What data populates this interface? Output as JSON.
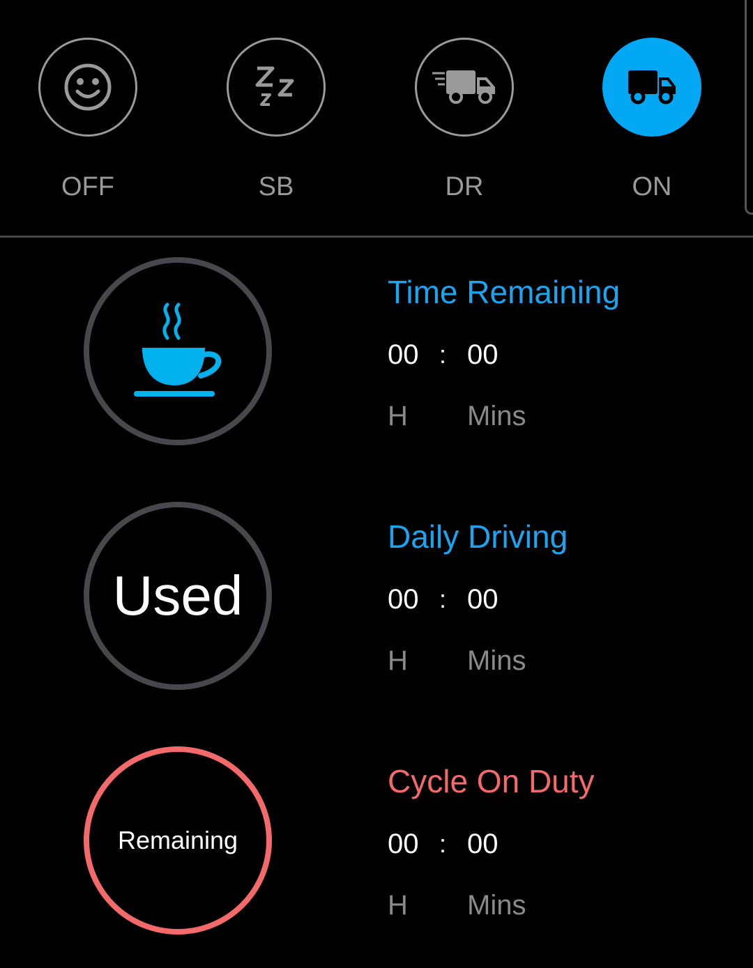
{
  "status_buttons": [
    {
      "label": "OFF",
      "icon": "smiley-icon",
      "active": false
    },
    {
      "label": "SB",
      "icon": "sleep-zzz-icon",
      "active": false
    },
    {
      "label": "DR",
      "icon": "moving-truck-icon",
      "active": false
    },
    {
      "label": "ON",
      "icon": "truck-icon",
      "active": true
    }
  ],
  "colors": {
    "accent_blue": "#02a8f4",
    "title_blue": "#1ba4ef",
    "warning_red": "#f46a6a",
    "ring_gray": "#48484c",
    "label_gray": "#9a9a9a"
  },
  "rows": [
    {
      "circle_icon": "coffee-cup-icon",
      "title": "Time Remaining",
      "hours": "00",
      "separator": ":",
      "minutes": "00",
      "hours_unit": "H",
      "minutes_unit": "Mins"
    },
    {
      "circle_text": "Used",
      "title": "Daily Driving",
      "hours": "00",
      "separator": ":",
      "minutes": "00",
      "hours_unit": "H",
      "minutes_unit": "Mins"
    },
    {
      "circle_text": "Remaining",
      "title": "Cycle On Duty",
      "hours": "00",
      "separator": ":",
      "minutes": "00",
      "hours_unit": "H",
      "minutes_unit": "Mins"
    }
  ]
}
